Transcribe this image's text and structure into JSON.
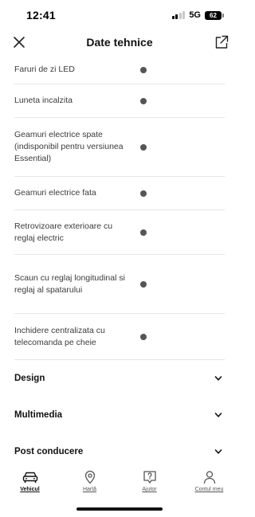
{
  "status": {
    "time": "12:41",
    "network": "5G",
    "battery": "62"
  },
  "header": {
    "title": "Date tehnice"
  },
  "features": [
    "Faruri de zi LED",
    "Luneta incalzita",
    "Geamuri electrice spate (indisponibil pentru versiunea Essential)",
    "Geamuri electrice fata",
    "Retrovizoare exterioare cu reglaj electric",
    "Scaun cu reglaj longitudinal si reglaj al spatarului",
    "Inchidere centralizata cu telecomanda pe cheie"
  ],
  "sections": [
    "Design",
    "Multimedia",
    "Post conducere"
  ],
  "tabs": [
    {
      "label": "Vehicul",
      "icon": "car-icon",
      "active": true
    },
    {
      "label": "Hartă",
      "icon": "map-pin-icon",
      "active": false
    },
    {
      "label": "Ajutor",
      "icon": "help-icon",
      "active": false
    },
    {
      "label": "Contul meu",
      "icon": "user-icon",
      "active": false
    }
  ],
  "colors": {
    "dot": "#555555",
    "divider": "#e6e6e6",
    "text": "#3b3b3b"
  }
}
